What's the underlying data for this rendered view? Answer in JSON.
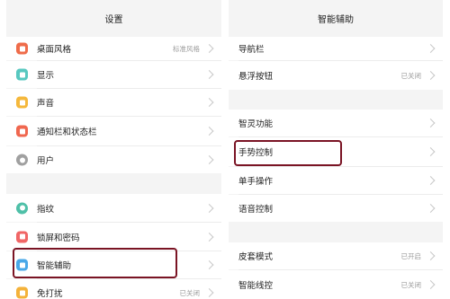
{
  "left": {
    "title": "设置",
    "group1": [
      {
        "label": "桌面风格",
        "value": "标准风格",
        "icon": "desktop-style-icon",
        "color": "#ef6c4a"
      },
      {
        "label": "显示",
        "value": "",
        "icon": "display-icon",
        "color": "#58c8c0"
      },
      {
        "label": "声音",
        "value": "",
        "icon": "sound-icon",
        "color": "#f5b83c"
      },
      {
        "label": "通知栏和状态栏",
        "value": "",
        "icon": "notification-icon",
        "color": "#f0674f"
      },
      {
        "label": "用户",
        "value": "",
        "icon": "user-icon",
        "color": "#a0a0a0"
      }
    ],
    "group2": [
      {
        "label": "指纹",
        "value": "",
        "icon": "fingerprint-icon",
        "color": "#4fc0a8"
      },
      {
        "label": "锁屏和密码",
        "value": "",
        "icon": "lock-icon",
        "color": "#f06666"
      },
      {
        "label": "智能辅助",
        "value": "",
        "icon": "smart-assist-icon",
        "color": "#4aa8e8"
      },
      {
        "label": "免打扰",
        "value": "已关闭",
        "icon": "do-not-disturb-icon",
        "color": "#f4b23a"
      }
    ]
  },
  "right": {
    "title": "智能辅助",
    "group1": [
      {
        "label": "导航栏",
        "value": ""
      },
      {
        "label": "悬浮按钮",
        "value": "已关闭"
      }
    ],
    "group2": [
      {
        "label": "智灵功能",
        "value": ""
      },
      {
        "label": "手势控制",
        "value": ""
      },
      {
        "label": "单手操作",
        "value": ""
      },
      {
        "label": "语音控制",
        "value": ""
      }
    ],
    "group3": [
      {
        "label": "皮套模式",
        "value": "已开启"
      },
      {
        "label": "智能线控",
        "value": "已关闭"
      }
    ]
  },
  "annotation_color": "#7a1424"
}
